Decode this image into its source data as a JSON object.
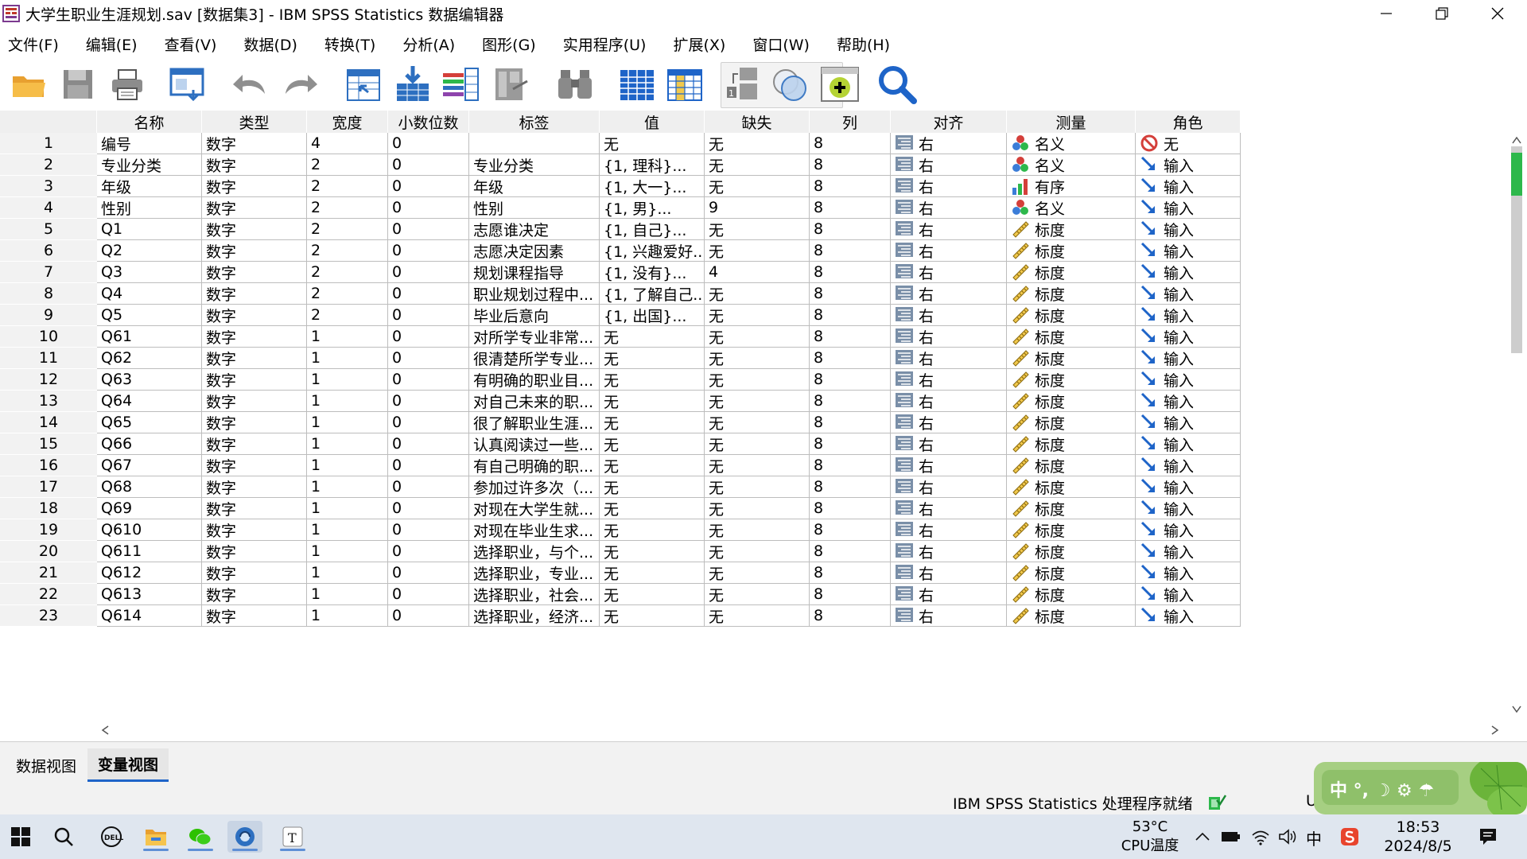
{
  "window": {
    "title": "大学生职业生涯规划.sav [数据集3] - IBM SPSS Statistics 数据编辑器",
    "controls": {
      "minimize": "minimize-icon",
      "restore": "restore-icon",
      "close": "close-icon"
    }
  },
  "menu": [
    "文件(F)",
    "编辑(E)",
    "查看(V)",
    "数据(D)",
    "转换(T)",
    "分析(A)",
    "图形(G)",
    "实用程序(U)",
    "扩展(X)",
    "窗口(W)",
    "帮助(H)"
  ],
  "toolbar": [
    "open-folder-icon",
    "save-icon",
    "print-icon",
    "recall-dialog-icon",
    "undo-icon",
    "redo-icon",
    "goto-case-icon",
    "goto-variable-icon",
    "variables-icon",
    "run-descriptives-icon",
    "find-icon",
    "insert-cases-icon",
    "insert-variable-icon",
    "split-file-icon",
    "select-cases-icon",
    "value-labels-icon",
    "search-icon"
  ],
  "grid": {
    "columns": [
      "名称",
      "类型",
      "宽度",
      "小数位数",
      "标签",
      "值",
      "缺失",
      "列",
      "对齐",
      "测量",
      "角色"
    ],
    "rows": [
      [
        "1",
        "编号",
        "数字",
        "4",
        "0",
        "",
        "无",
        "无",
        "8",
        "右",
        "名义",
        "无"
      ],
      [
        "2",
        "专业分类",
        "数字",
        "2",
        "0",
        "专业分类",
        "{1, 理科}...",
        "无",
        "8",
        "右",
        "名义",
        "输入"
      ],
      [
        "3",
        "年级",
        "数字",
        "2",
        "0",
        "年级",
        "{1, 大一}...",
        "无",
        "8",
        "右",
        "有序",
        "输入"
      ],
      [
        "4",
        "性别",
        "数字",
        "2",
        "0",
        "性别",
        "{1, 男}...",
        "9",
        "8",
        "右",
        "名义",
        "输入"
      ],
      [
        "5",
        "Q1",
        "数字",
        "2",
        "0",
        "志愿谁决定",
        "{1, 自己}...",
        "无",
        "8",
        "右",
        "标度",
        "输入"
      ],
      [
        "6",
        "Q2",
        "数字",
        "2",
        "0",
        "志愿决定因素",
        "{1, 兴趣爱好...",
        "无",
        "8",
        "右",
        "标度",
        "输入"
      ],
      [
        "7",
        "Q3",
        "数字",
        "2",
        "0",
        "规划课程指导",
        "{1, 没有}...",
        "4",
        "8",
        "右",
        "标度",
        "输入"
      ],
      [
        "8",
        "Q4",
        "数字",
        "2",
        "0",
        "职业规划过程中...",
        "{1, 了解自己...",
        "无",
        "8",
        "右",
        "标度",
        "输入"
      ],
      [
        "9",
        "Q5",
        "数字",
        "2",
        "0",
        "毕业后意向",
        "{1, 出国}...",
        "无",
        "8",
        "右",
        "标度",
        "输入"
      ],
      [
        "10",
        "Q61",
        "数字",
        "1",
        "0",
        "对所学专业非常...",
        "无",
        "无",
        "8",
        "右",
        "标度",
        "输入"
      ],
      [
        "11",
        "Q62",
        "数字",
        "1",
        "0",
        "很清楚所学专业...",
        "无",
        "无",
        "8",
        "右",
        "标度",
        "输入"
      ],
      [
        "12",
        "Q63",
        "数字",
        "1",
        "0",
        "有明确的职业目...",
        "无",
        "无",
        "8",
        "右",
        "标度",
        "输入"
      ],
      [
        "13",
        "Q64",
        "数字",
        "1",
        "0",
        "对自己未来的职...",
        "无",
        "无",
        "8",
        "右",
        "标度",
        "输入"
      ],
      [
        "14",
        "Q65",
        "数字",
        "1",
        "0",
        "很了解职业生涯...",
        "无",
        "无",
        "8",
        "右",
        "标度",
        "输入"
      ],
      [
        "15",
        "Q66",
        "数字",
        "1",
        "0",
        "认真阅读过一些...",
        "无",
        "无",
        "8",
        "右",
        "标度",
        "输入"
      ],
      [
        "16",
        "Q67",
        "数字",
        "1",
        "0",
        "有自己明确的职...",
        "无",
        "无",
        "8",
        "右",
        "标度",
        "输入"
      ],
      [
        "17",
        "Q68",
        "数字",
        "1",
        "0",
        "参加过许多次（...",
        "无",
        "无",
        "8",
        "右",
        "标度",
        "输入"
      ],
      [
        "18",
        "Q69",
        "数字",
        "1",
        "0",
        "对现在大学生就...",
        "无",
        "无",
        "8",
        "右",
        "标度",
        "输入"
      ],
      [
        "19",
        "Q610",
        "数字",
        "1",
        "0",
        "对现在毕业生求...",
        "无",
        "无",
        "8",
        "右",
        "标度",
        "输入"
      ],
      [
        "20",
        "Q611",
        "数字",
        "1",
        "0",
        "选择职业，与个...",
        "无",
        "无",
        "8",
        "右",
        "标度",
        "输入"
      ],
      [
        "21",
        "Q612",
        "数字",
        "1",
        "0",
        "选择职业，专业...",
        "无",
        "无",
        "8",
        "右",
        "标度",
        "输入"
      ],
      [
        "22",
        "Q613",
        "数字",
        "1",
        "0",
        "选择职业，社会...",
        "无",
        "无",
        "8",
        "右",
        "标度",
        "输入"
      ]
    ],
    "partial_row": [
      "23",
      "Q614",
      "数字",
      "1",
      "0",
      "选择职业，经济...",
      "无",
      "无",
      "8",
      "右",
      "标度",
      "输入"
    ]
  },
  "tabs": {
    "data_view": "数据视图",
    "variable_view": "变量视图",
    "active": "variable_view"
  },
  "status": {
    "text": "IBM SPSS Statistics 处理程序就绪",
    "extra": "U"
  },
  "ime": {
    "text": "中 °, ☽ ⚙ ☂"
  },
  "taskbar": {
    "icons": [
      "windows-start-icon",
      "search-icon",
      "dell-icon",
      "file-explorer-icon",
      "wechat-icon",
      "spss-icon",
      "typora-icon"
    ],
    "temp_value": "53°C",
    "temp_label": "CPU温度",
    "ime_lang": "中",
    "time": "18:53",
    "date": "2024/8/5"
  },
  "colors": {
    "accent": "#1e64c8",
    "header_bg": "#efefef",
    "grid_line": "#bdbdbd",
    "taskbar": "#dfe6ef",
    "status_green": "#2db84b"
  }
}
